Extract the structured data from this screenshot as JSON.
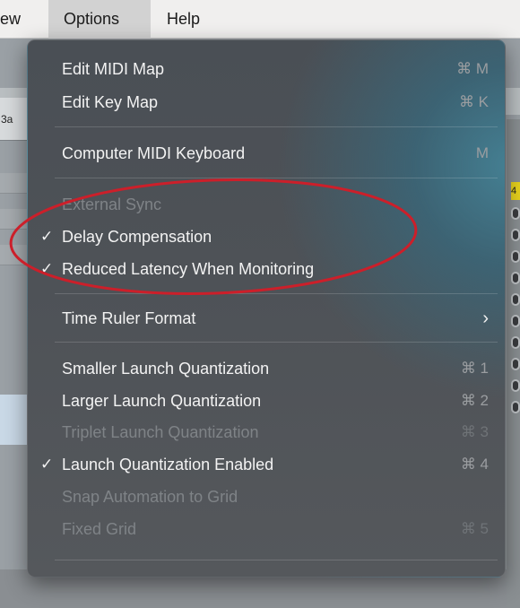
{
  "menubar": {
    "view_label": "ew",
    "options_label": "Options",
    "help_label": "Help"
  },
  "background": {
    "tab_label": "3a",
    "badge_label": "4"
  },
  "menu": {
    "items": [
      {
        "label": "Edit MIDI Map",
        "shortcut": "⌘ M",
        "checked": false,
        "enabled": true
      },
      {
        "label": "Edit Key Map",
        "shortcut": "⌘ K",
        "checked": false,
        "enabled": true
      },
      {
        "label": "Computer MIDI Keyboard",
        "shortcut": "M",
        "checked": false,
        "enabled": true
      },
      {
        "label": "External Sync",
        "shortcut": "",
        "checked": false,
        "enabled": false
      },
      {
        "label": "Delay Compensation",
        "shortcut": "",
        "checked": true,
        "enabled": true
      },
      {
        "label": "Reduced Latency When Monitoring",
        "shortcut": "",
        "checked": true,
        "enabled": true
      },
      {
        "label": "Time Ruler Format",
        "shortcut": "",
        "checked": false,
        "enabled": true,
        "submenu": true
      },
      {
        "label": "Smaller Launch Quantization",
        "shortcut": "⌘ 1",
        "checked": false,
        "enabled": true
      },
      {
        "label": "Larger Launch Quantization",
        "shortcut": "⌘ 2",
        "checked": false,
        "enabled": true
      },
      {
        "label": "Triplet Launch Quantization",
        "shortcut": "⌘ 3",
        "checked": false,
        "enabled": false
      },
      {
        "label": "Launch Quantization Enabled",
        "shortcut": "⌘ 4",
        "checked": true,
        "enabled": true
      },
      {
        "label": "Snap Automation to Grid",
        "shortcut": "",
        "checked": false,
        "enabled": false
      },
      {
        "label": "Fixed Grid",
        "shortcut": "⌘ 5",
        "checked": false,
        "enabled": false
      }
    ],
    "check_glyph": "✓",
    "submenu_glyph": "›"
  },
  "colors": {
    "annotation": "#cc1f2a",
    "menu_text": "#f3f3f3",
    "menu_disabled_text": "#7f8387"
  }
}
